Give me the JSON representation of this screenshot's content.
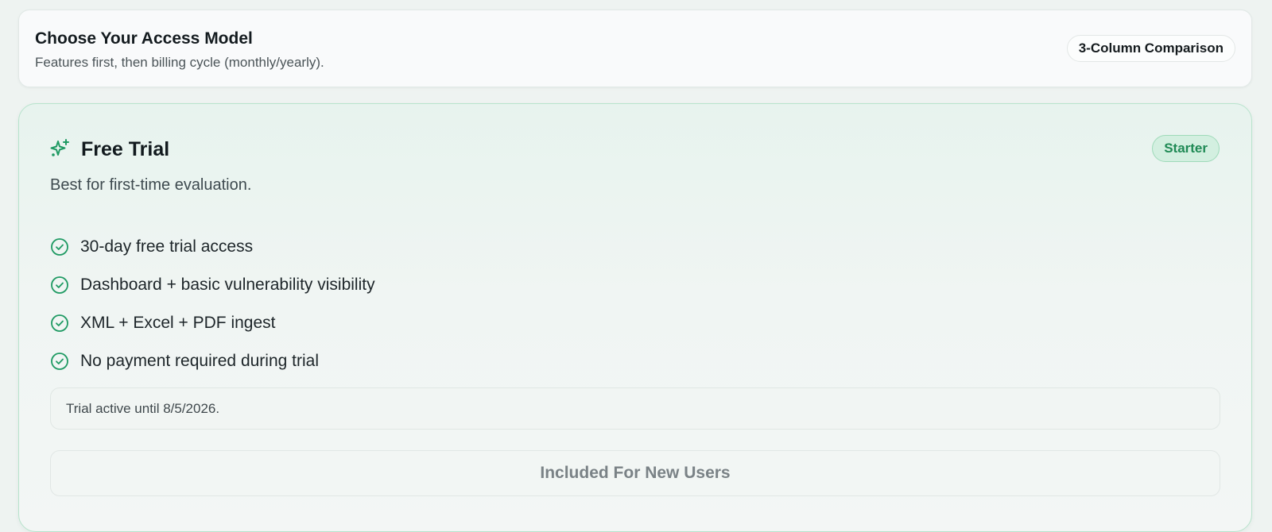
{
  "header": {
    "title": "Choose Your Access Model",
    "subtitle": "Features first, then billing cycle (monthly/yearly).",
    "comparison_label": "3-Column Comparison"
  },
  "plan": {
    "icon": "sparkles-icon",
    "name": "Free Trial",
    "badge": "Starter",
    "description": "Best for first-time evaluation.",
    "features": [
      "30-day free trial access",
      "Dashboard + basic vulnerability visibility",
      "XML + Excel + PDF ingest",
      "No payment required during trial"
    ],
    "trial_status": "Trial active until 8/5/2026.",
    "cta_label": "Included For New Users"
  },
  "colors": {
    "accent": "#1f9a63",
    "badge_bg": "#d3efe0",
    "card_border": "#b7e3cc"
  }
}
